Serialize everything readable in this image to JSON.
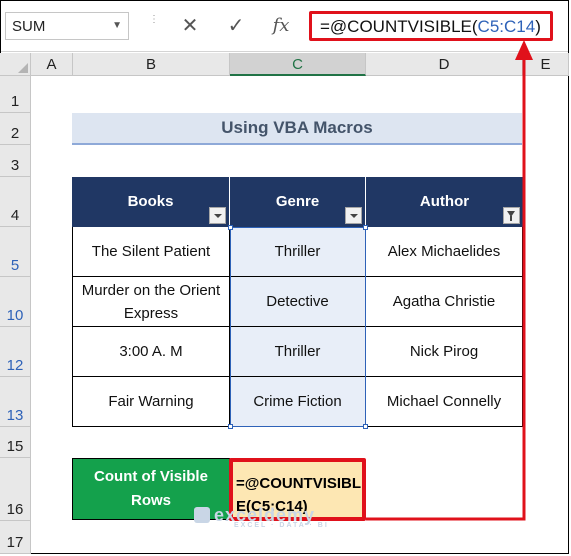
{
  "formula_bar": {
    "name_box": "SUM",
    "cancel_icon": "✕",
    "enter_icon": "✓",
    "fx_icon": "fx",
    "formula_prefix": "=@COUNTVISIBLE(",
    "formula_ref": "C5:C14",
    "formula_suffix": ")"
  },
  "columns": [
    "A",
    "B",
    "C",
    "D",
    "E"
  ],
  "rows": [
    "1",
    "2",
    "3",
    "4",
    "5",
    "10",
    "12",
    "13",
    "15",
    "16",
    "17"
  ],
  "title": "Using VBA Macros",
  "table": {
    "headers": [
      "Books",
      "Genre",
      "Author"
    ],
    "rows": [
      {
        "book": "The Silent Patient",
        "genre": "Thriller",
        "author": "Alex Michaelides"
      },
      {
        "book": "Murder on the Orient Express",
        "genre": "Detective",
        "author": "Agatha Christie"
      },
      {
        "book": "3:00 A. M",
        "genre": "Thriller",
        "author": "Nick Pirog"
      },
      {
        "book": "Fair Warning",
        "genre": "Crime Fiction",
        "author": "Michael Connelly"
      }
    ]
  },
  "count": {
    "label": "Count of Visible Rows",
    "editing_text_line1": "=@COUNTVISIBL",
    "editing_text_line2": "E(C5:C14)"
  },
  "watermark": {
    "name": "exceldemy",
    "tagline": "EXCEL · DATA · BI"
  },
  "colors": {
    "accent_red": "#e0111b",
    "header_blue": "#203764",
    "count_green": "#14a14c",
    "highlight": "#fde7b3"
  }
}
